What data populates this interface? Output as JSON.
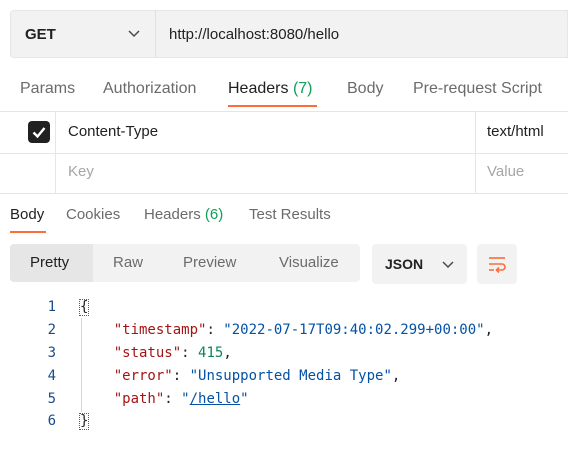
{
  "request": {
    "method": "GET",
    "url": "http://localhost:8080/hello",
    "tabs": [
      {
        "label": "Params"
      },
      {
        "label": "Authorization"
      },
      {
        "label": "Headers",
        "count": "(7)"
      },
      {
        "label": "Body"
      },
      {
        "label": "Pre-request Script"
      }
    ],
    "active_tab": "Headers"
  },
  "headers_table": {
    "rows": [
      {
        "checked": true,
        "key": "Content-Type",
        "value": "text/html"
      }
    ],
    "key_placeholder": "Key",
    "value_placeholder": "Value"
  },
  "response": {
    "tabs": [
      {
        "label": "Body"
      },
      {
        "label": "Cookies"
      },
      {
        "label": "Headers",
        "count": "(6)"
      },
      {
        "label": "Test Results"
      }
    ],
    "active_tab": "Body",
    "view_modes": [
      "Pretty",
      "Raw",
      "Preview",
      "Visualize"
    ],
    "active_view": "Pretty",
    "language": "JSON",
    "code": {
      "line_numbers": [
        "1",
        "2",
        "3",
        "4",
        "5",
        "6"
      ],
      "open_brace": "{",
      "close_brace": "}",
      "timestamp_key": "\"timestamp\"",
      "timestamp_value": "\"2022-07-17T09:40:02.299+00:00\"",
      "status_key": "\"status\"",
      "status_value": "415",
      "error_key": "\"error\"",
      "error_value": "\"Unsupported Media Type\"",
      "path_key": "\"path\"",
      "path_quote": "\"",
      "path_value": "/hello"
    }
  },
  "colors": {
    "accent": "#ff6c37",
    "count_green": "#0f9d58",
    "json_key": "#a31515",
    "json_string": "#0451a5",
    "json_number": "#098658"
  }
}
